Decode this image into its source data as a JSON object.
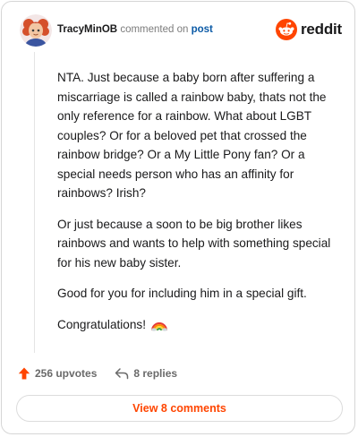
{
  "header": {
    "username": "TracyMinOB",
    "action_text": "commented on",
    "post_link": "post",
    "brand": "reddit"
  },
  "comment": {
    "paragraphs": [
      "NTA. Just because a baby born after suffering a miscarriage is called a rainbow baby, thats not the only reference for a rainbow. What about LGBT couples? Or for a beloved pet that crossed the rainbow bridge? Or a My Little Pony fan? Or a special needs person who has an affinity for rainbows? Irish?",
      "Or just because a soon to be big brother likes rainbows and wants to help with something special for his new baby sister.",
      "Good for you for including him in a special gift.",
      "Congratulations!"
    ]
  },
  "footer": {
    "upvotes": "256 upvotes",
    "replies": "8 replies",
    "view_button": "View 8 comments"
  },
  "icons": {
    "avatar": "user-avatar",
    "brand": "reddit-alien-icon",
    "upvote": "upvote-arrow-icon",
    "reply": "reply-arrow-icon",
    "emoji": "rainbow-emoji"
  },
  "colors": {
    "accent": "#ff4500",
    "link": "#0b5aa6",
    "muted": "#7c7c7c"
  }
}
